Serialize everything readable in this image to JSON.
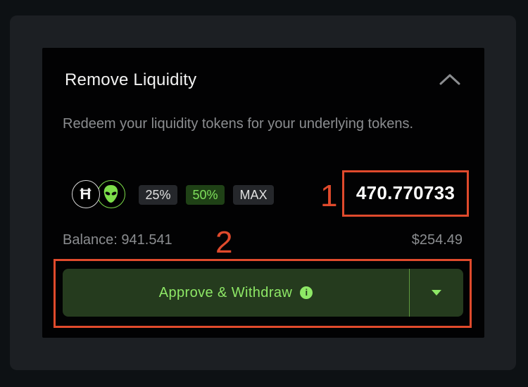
{
  "panel": {
    "title": "Remove Liquidity",
    "description": "Redeem your liquidity tokens for your underlying tokens."
  },
  "tokens": [
    {
      "symbol_letter": "Ħ",
      "icon": "hbar-token-icon",
      "ring_color": "#d9d9d9"
    },
    {
      "icon": "alien-token-icon",
      "ring_color": "#7dde4a"
    }
  ],
  "percent_options": [
    {
      "label": "25%",
      "selected": false
    },
    {
      "label": "50%",
      "selected": true
    },
    {
      "label": "MAX",
      "selected": false
    }
  ],
  "amount_value": "470.770733",
  "balance_text": "Balance: 941.541",
  "usd_value": "$254.49",
  "action": {
    "label": "Approve & Withdraw",
    "info_glyph": "i",
    "dropdown_icon": "caret-down-icon"
  },
  "annotations": [
    {
      "label": "1"
    },
    {
      "label": "2"
    }
  ],
  "colors": {
    "accent_green": "#8ee866",
    "button_bg": "#253b1e",
    "annotation_red": "#e04a2c"
  }
}
